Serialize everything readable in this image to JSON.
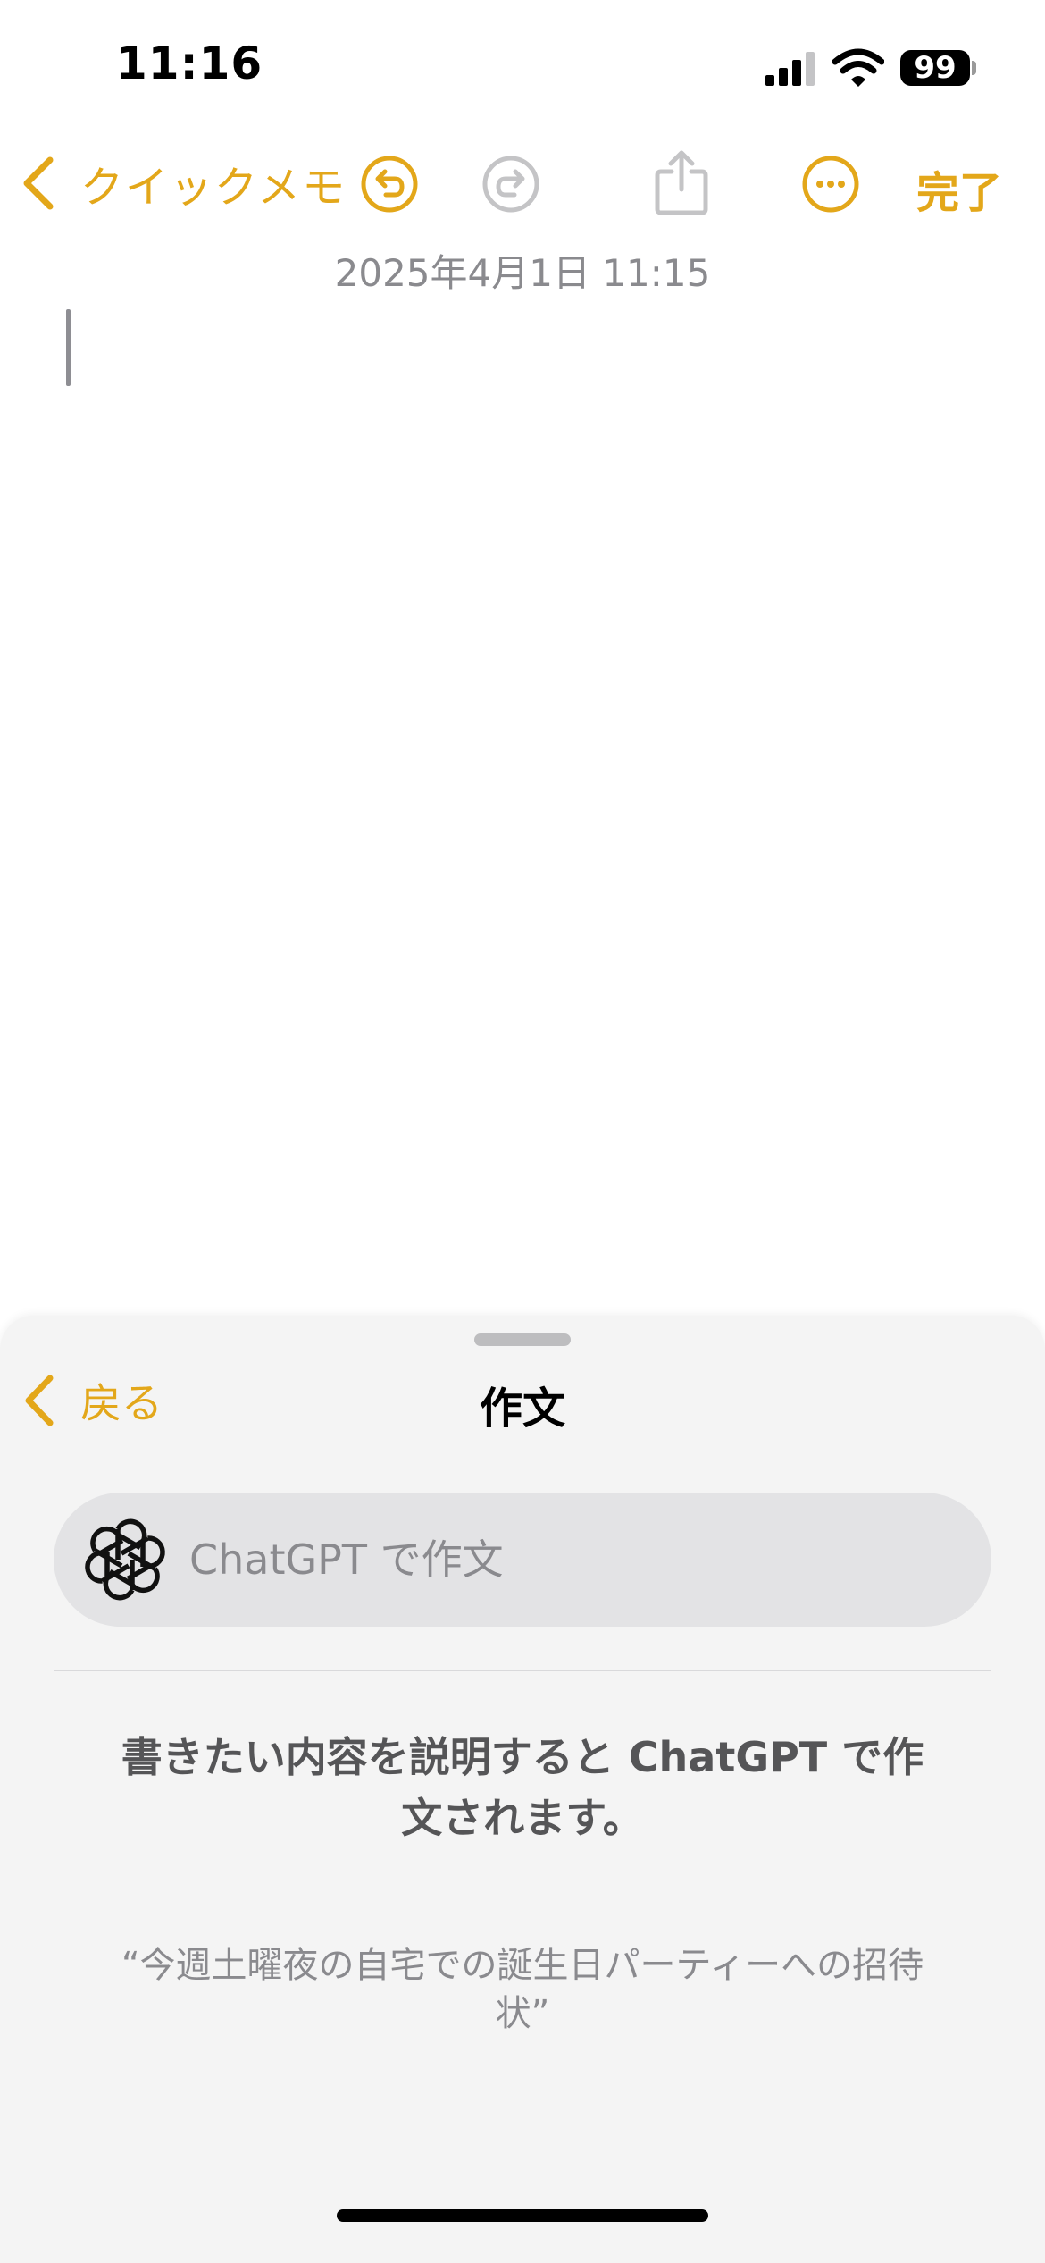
{
  "status_bar": {
    "time": "11:16",
    "battery": "99"
  },
  "toolbar": {
    "back_label": "クイックメモ",
    "done_label": "完了",
    "icons": [
      "chevron-left-icon",
      "undo-icon",
      "redo-icon",
      "share-icon",
      "more-icon"
    ]
  },
  "note": {
    "date": "2025年4月1日 11:15",
    "content": ""
  },
  "sheet": {
    "back_label": "戻る",
    "title": "作文",
    "input_placeholder": "ChatGPT で作文",
    "description": "書きたい内容を説明すると ChatGPT で作文されます。",
    "example": "“今週土曜夜の自宅での誕生日パーティーへの招待状”"
  },
  "colors": {
    "accent": "#e3a71a",
    "sheet_background": "#f4f4f4",
    "input_background": "#e3e3e5",
    "secondary_text": "#8a8a8e"
  }
}
